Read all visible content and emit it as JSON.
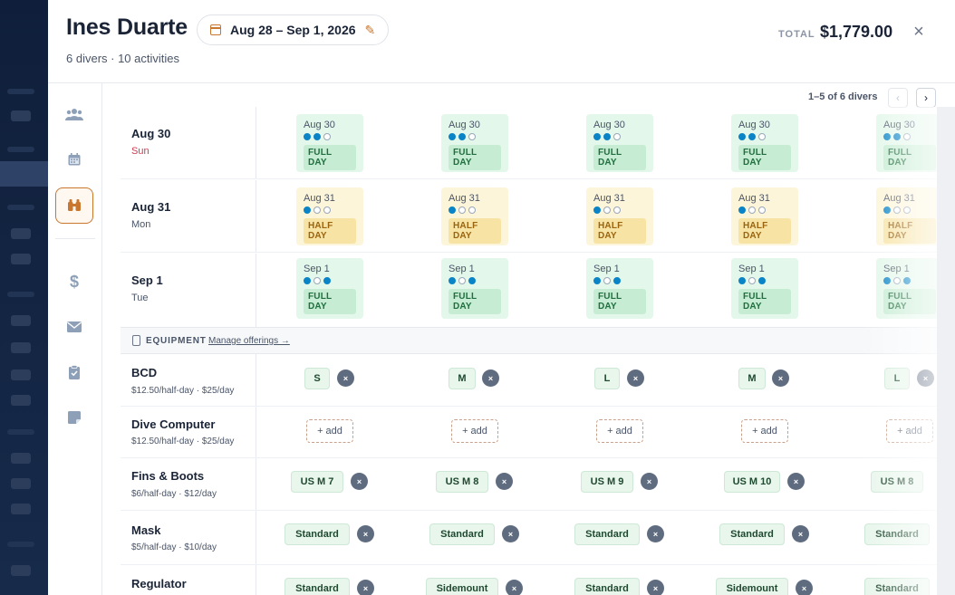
{
  "header": {
    "title": "Ines Duarte",
    "subtitle": "6 divers · 10 activities",
    "date_range": "Aug 28 – Sep 1, 2026",
    "total_label": "TOTAL",
    "total_value": "$1,779.00"
  },
  "icons": {
    "close": "×",
    "pencil": "✎",
    "prev": "‹",
    "next": "›",
    "remove": "×",
    "nav": [
      "people-icon",
      "calendar-icon",
      "binoculars-icon",
      "dollar-icon",
      "envelope-icon",
      "clipboard-icon",
      "note-icon"
    ]
  },
  "pager": {
    "text": "1–5 of 6 divers"
  },
  "days": [
    {
      "date": "Aug 30",
      "dow": "Sun",
      "cells": [
        {
          "label": "Aug 30",
          "dots": [
            1,
            1,
            0
          ],
          "tag": "FULL DAY",
          "kind": "full"
        },
        {
          "label": "Aug 30",
          "dots": [
            1,
            1,
            0
          ],
          "tag": "FULL DAY",
          "kind": "full"
        },
        {
          "label": "Aug 30",
          "dots": [
            1,
            1,
            0
          ],
          "tag": "FULL DAY",
          "kind": "full"
        },
        {
          "label": "Aug 30",
          "dots": [
            1,
            1,
            0
          ],
          "tag": "FULL DAY",
          "kind": "full"
        },
        {
          "label": "Aug 30",
          "dots": [
            1,
            1,
            0
          ],
          "tag": "FULL DAY",
          "kind": "full"
        }
      ]
    },
    {
      "date": "Aug 31",
      "dow": "Mon",
      "cells": [
        {
          "label": "Aug 31",
          "dots": [
            1,
            0,
            0
          ],
          "tag": "HALF DAY",
          "kind": "half"
        },
        {
          "label": "Aug 31",
          "dots": [
            1,
            0,
            0
          ],
          "tag": "HALF DAY",
          "kind": "half"
        },
        {
          "label": "Aug 31",
          "dots": [
            1,
            0,
            0
          ],
          "tag": "HALF DAY",
          "kind": "half"
        },
        {
          "label": "Aug 31",
          "dots": [
            1,
            0,
            0
          ],
          "tag": "HALF DAY",
          "kind": "half"
        },
        {
          "label": "Aug 31",
          "dots": [
            1,
            0,
            0
          ],
          "tag": "HALF DAY",
          "kind": "half"
        }
      ]
    },
    {
      "date": "Sep 1",
      "dow": "Tue",
      "cells": [
        {
          "label": "Sep 1",
          "dots": [
            1,
            0,
            1
          ],
          "tag": "FULL DAY",
          "kind": "full"
        },
        {
          "label": "Sep 1",
          "dots": [
            1,
            0,
            1
          ],
          "tag": "FULL DAY",
          "kind": "full"
        },
        {
          "label": "Sep 1",
          "dots": [
            1,
            0,
            1
          ],
          "tag": "FULL DAY",
          "kind": "full"
        },
        {
          "label": "Sep 1",
          "dots": [
            1,
            0,
            1
          ],
          "tag": "FULL DAY",
          "kind": "full"
        },
        {
          "label": "Sep 1",
          "dots": [
            1,
            0,
            1
          ],
          "tag": "FULL DAY",
          "kind": "full"
        }
      ]
    }
  ],
  "equipment_section": {
    "title": "EQUIPMENT",
    "link": "Manage offerings →"
  },
  "add_label": "+ add",
  "equipment": [
    {
      "name": "BCD",
      "price": "$12.50/half-day · $25/day",
      "values": [
        "S",
        "M",
        "L",
        "M",
        "L"
      ]
    },
    {
      "name": "Dive Computer",
      "price": "$12.50/half-day · $25/day",
      "values": [
        null,
        null,
        null,
        null,
        null
      ]
    },
    {
      "name": "Fins & Boots",
      "price": "$6/half-day · $12/day",
      "values": [
        "US M 7",
        "US M 8",
        "US M 9",
        "US M 10",
        "US M 8"
      ]
    },
    {
      "name": "Mask",
      "price": "$5/half-day · $10/day",
      "values": [
        "Standard",
        "Standard",
        "Standard",
        "Standard",
        "Standard"
      ]
    },
    {
      "name": "Regulator",
      "price": "",
      "values": [
        "Standard",
        "Sidemount",
        "Standard",
        "Sidemount",
        "Standard"
      ]
    }
  ]
}
